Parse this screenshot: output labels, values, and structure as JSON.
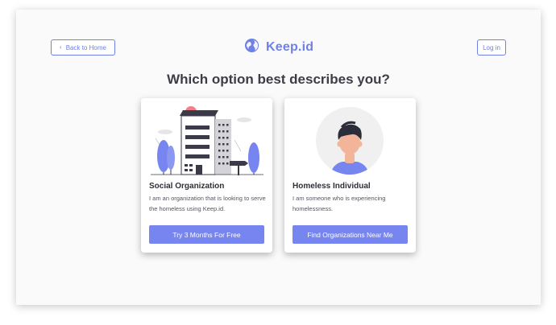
{
  "nav": {
    "back_label": "Back to Home",
    "login_label": "Log in"
  },
  "brand": {
    "name": "Keep.id",
    "accent_color": "#6f80e8"
  },
  "heading": "Which option best describes you?",
  "cards": [
    {
      "title": "Social Organization",
      "description": "I am an organization that is looking to serve the homeless using Keep.id.",
      "button_label": "Try 3 Months For Free",
      "illustration": "building-illustration"
    },
    {
      "title": "Homeless Individual",
      "description": "I am someone who is experiencing homelessness.",
      "button_label": "Find Organizations Near Me",
      "illustration": "person-avatar-illustration"
    }
  ],
  "colors": {
    "button_bg": "#7685ef",
    "heading_text": "#3d3d48",
    "avatar_bg": "#f0f0f0"
  }
}
